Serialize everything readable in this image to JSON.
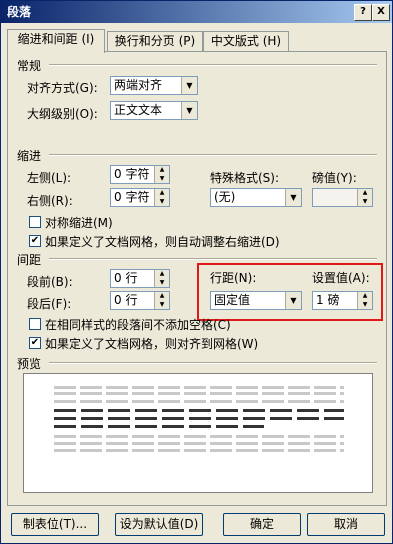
{
  "window": {
    "title": "段落",
    "help_label": "?",
    "close_label": "X"
  },
  "tabs": [
    {
      "label": "缩进和间距 (I)"
    },
    {
      "label": "换行和分页 (P)"
    },
    {
      "label": "中文版式 (H)"
    }
  ],
  "general": {
    "group_label": "常规",
    "alignment_label": "对齐方式(G):",
    "alignment_value": "两端对齐",
    "outline_label": "大纲级别(O):",
    "outline_value": "正文文本"
  },
  "indent": {
    "group_label": "缩进",
    "left_label": "左侧(L):",
    "left_value": "0 字符",
    "right_label": "右侧(R):",
    "right_value": "0 字符",
    "special_label": "特殊格式(S):",
    "special_value": "(无)",
    "by_label": "磅值(Y):",
    "by_value": "",
    "mirror_label": "对称缩进(M)",
    "mirror_checked": false,
    "auto_adjust_label": "如果定义了文档网格，则自动调整右缩进(D)",
    "auto_adjust_checked": true
  },
  "spacing": {
    "group_label": "间距",
    "before_label": "段前(B):",
    "before_value": "0 行",
    "after_label": "段后(F):",
    "after_value": "0 行",
    "line_spacing_label": "行距(N):",
    "line_spacing_value": "固定值",
    "at_label": "设置值(A):",
    "at_value": "1 磅",
    "no_space_label": "在相同样式的段落间不添加空格(C)",
    "no_space_checked": false,
    "snap_grid_label": "如果定义了文档网格，则对齐到网格(W)",
    "snap_grid_checked": true
  },
  "preview": {
    "group_label": "预览"
  },
  "buttons": {
    "tabs_label": "制表位(T)...",
    "default_label": "设为默认值(D)",
    "ok_label": "确定",
    "cancel_label": "取消"
  },
  "colors": {
    "highlight_box": "#e01818",
    "title_bar": "#0a246a"
  }
}
